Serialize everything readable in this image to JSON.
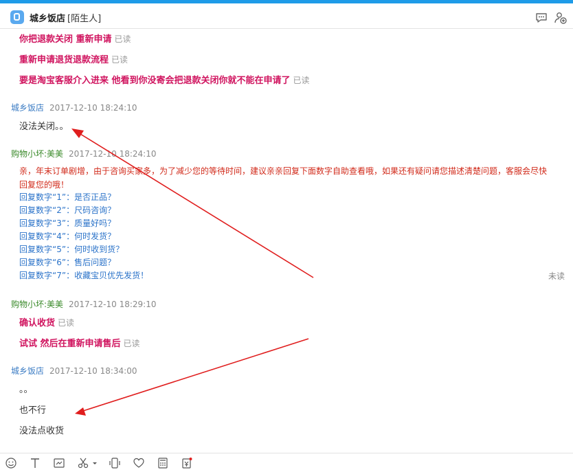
{
  "header": {
    "title": "城乡饭店",
    "tag": "[陌生人]"
  },
  "messages": {
    "m1": {
      "text": "你把退款关闭 重新申请",
      "status": "已读"
    },
    "m2": {
      "text": "重新申请退货退款流程",
      "status": "已读"
    },
    "m3": {
      "text": "要是淘宝客服介入进来 他看到你没寄会把退款关闭你就不能在申请了",
      "status": "已读"
    },
    "s1": {
      "sender": "城乡饭店",
      "time": "2017-12-10 18:24:10",
      "text": "没法关闭。。"
    },
    "b1": {
      "sender": "购物小坏:美美",
      "time": "2017-12-10 18:24:10",
      "line1": "亲，年末订单剧增，由于咨询买家多，为了减少您的等待时间，建议亲亲回复下面数字自助查看哦，如果还有疑问请您描述清楚问题，客服会尽快",
      "line2": "回复您的哦！",
      "options": [
        "回复数字“1”：是否正品？",
        "回复数字“2”：尺码咨询？",
        "回复数字“3”：质量好吗？",
        "回复数字“4”：何时发货？",
        "回复数字“5”：何时收到货？",
        "回复数字“6”：售后问题？",
        "回复数字“7”：收藏宝贝优先发货！"
      ],
      "status": "未读"
    },
    "b2": {
      "sender": "购物小坏:美美",
      "time": "2017-12-10 18:29:10"
    },
    "m4": {
      "text": "确认收货",
      "status": "已读"
    },
    "m5": {
      "text": "试试 然后在重新申请售后",
      "status": "已读"
    },
    "s2": {
      "sender": "城乡饭店",
      "time": "2017-12-10 18:34:00",
      "line1": "。。",
      "line2": "也不行",
      "line3": "没法点收货"
    }
  },
  "toolbar": {
    "icons": [
      "emoji-icon",
      "text-format-icon",
      "screenshot-icon",
      "scissors-icon",
      "shake-icon",
      "favorite-icon",
      "calculator-icon",
      "coupon-icon"
    ]
  },
  "colors": {
    "accent": "#1e9be8",
    "seller_msg": "#d0145f",
    "annotation_arrow": "#e01e1e"
  }
}
